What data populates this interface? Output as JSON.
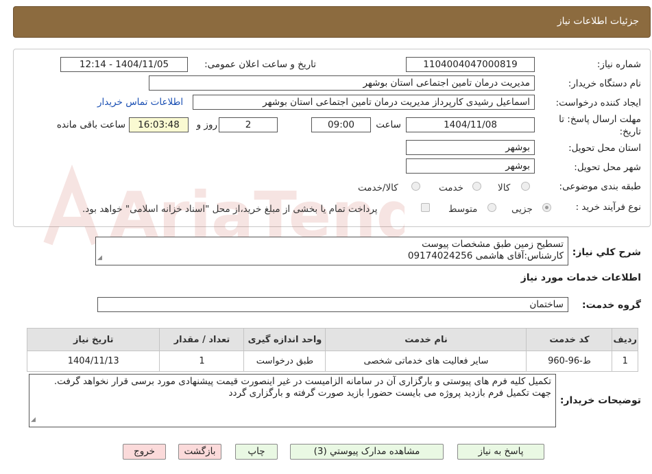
{
  "header": {
    "title": "جزئیات اطلاعات نیاز"
  },
  "watermark": {
    "text": "AriaTender.neT",
    "color": "#c0392b"
  },
  "form": {
    "need_number_label": "شماره نیاز:",
    "need_number": "1104004047000819",
    "announce_label": "تاریخ و ساعت اعلان عمومی:",
    "announce_value": "1404/11/05 - 12:14",
    "buyer_org_label": "نام دستگاه خریدار:",
    "buyer_org": "مدیریت درمان تامین اجتماعی استان بوشهر",
    "requester_label": "ایجاد کننده درخواست:",
    "requester": "اسماعیل رشیدی کارپرداز مدیریت درمان تامین اجتماعی استان بوشهر",
    "contact_link": "اطلاعات تماس خریدار",
    "deadline_label_1": "مهلت ارسال پاسخ: تا",
    "deadline_label_2": "تاریخ:",
    "deadline_date": "1404/11/08",
    "time_label": "ساعت",
    "deadline_time": "09:00",
    "days": "2",
    "days_label": "روز و",
    "remaining": "16:03:48",
    "remaining_label": "ساعت باقی مانده",
    "province_label": "استان محل تحویل:",
    "province": "بوشهر",
    "city_label": "شهر محل تحویل:",
    "city": "بوشهر",
    "category_label": "طبقه بندی موضوعی:",
    "category_options": [
      "کالا",
      "خدمت",
      "کالا/خدمت"
    ],
    "process_label": "نوع فرآیند خرید :",
    "process_options": [
      "جزیی",
      "متوسط"
    ],
    "payment_note": "پرداخت تمام یا بخشی از مبلغ خرید،از محل \"اسناد خزانه اسلامی\" خواهد بود."
  },
  "summary": {
    "label": "شرح کلي نياز:",
    "line1": "تسطیح زمین طبق مشخصات پیوست",
    "line2": "کارشناس:آقای هاشمی 09174024256"
  },
  "services": {
    "title": "اطلاعات خدمات مورد نياز",
    "group_label": "گروه خدمت:",
    "group_value": "ساختمان",
    "columns": [
      "رديف",
      "کد خدمت",
      "نام خدمت",
      "واحد اندازه گيری",
      "تعداد / مقدار",
      "تاريخ نياز"
    ],
    "rows": [
      [
        "1",
        "ط-96-960",
        "سایر فعالیت های خدماتی شخصی",
        "طبق درخواست",
        "1",
        "1404/11/13"
      ]
    ]
  },
  "buyer_notes": {
    "label": "توضيحات خريدار:",
    "text": "تکمیل کلیه فرم های پیوستی و بارگزاری آن در سامانه الزامیست در غیر اینصورت قیمت پیشنهادی مورد برسی قرار نخواهد گرفت. جهت تکمیل فرم بازدید پروژه می بایست حضورا بازید صورت گرفته و بارگزاری گردد"
  },
  "buttons": {
    "reply": "پاسخ به نیاز",
    "attachments": "مشاهده مدارک پیوستي (3)",
    "print": "چاپ",
    "back": "بازگشت",
    "exit": "خروج"
  }
}
